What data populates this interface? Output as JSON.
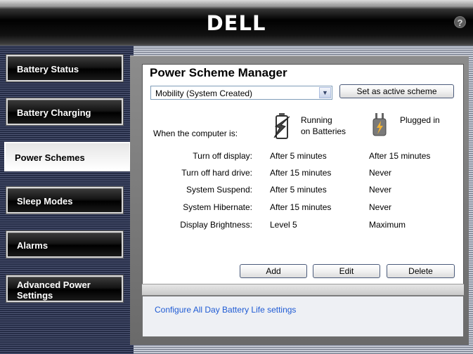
{
  "header": {
    "logo": "DELL",
    "help_glyph": "?"
  },
  "sidebar": {
    "items": [
      {
        "label": "Battery Status",
        "active": false
      },
      {
        "label": "Battery Charging",
        "active": false
      },
      {
        "label": "Power Schemes",
        "active": true
      },
      {
        "label": "Sleep Modes",
        "active": false
      },
      {
        "label": "Alarms",
        "active": false
      },
      {
        "label": "Advanced Power",
        "label2": "Settings",
        "active": false
      }
    ]
  },
  "main": {
    "title": "Power Scheme Manager",
    "scheme_select": {
      "value": "Mobility (System Created)",
      "arrow": "▼"
    },
    "set_active_label": "Set as active scheme",
    "when_label": "When the computer is:",
    "columns": {
      "battery": {
        "line1": "Running",
        "line2": "on Batteries",
        "icon": "battery-icon"
      },
      "plugged": {
        "line1": "Plugged in",
        "icon": "plug-icon"
      }
    },
    "rows": [
      {
        "label": "Turn off display:",
        "battery": "After 5 minutes",
        "plugged": "After 15 minutes"
      },
      {
        "label": "Turn off hard drive:",
        "battery": "After 15 minutes",
        "plugged": "Never"
      },
      {
        "label": "System Suspend:",
        "battery": "After 5 minutes",
        "plugged": "Never"
      },
      {
        "label": "System Hibernate:",
        "battery": "After 15 minutes",
        "plugged": "Never"
      },
      {
        "label": "Display Brightness:",
        "battery": "Level 5",
        "plugged": "Maximum"
      }
    ],
    "buttons": {
      "add": "Add",
      "edit": "Edit",
      "delete": "Delete"
    },
    "link": "Configure All Day Battery Life settings"
  },
  "colors": {
    "link": "#1f5bd4",
    "sidebar": "#2c3451",
    "banner": "#000000"
  }
}
